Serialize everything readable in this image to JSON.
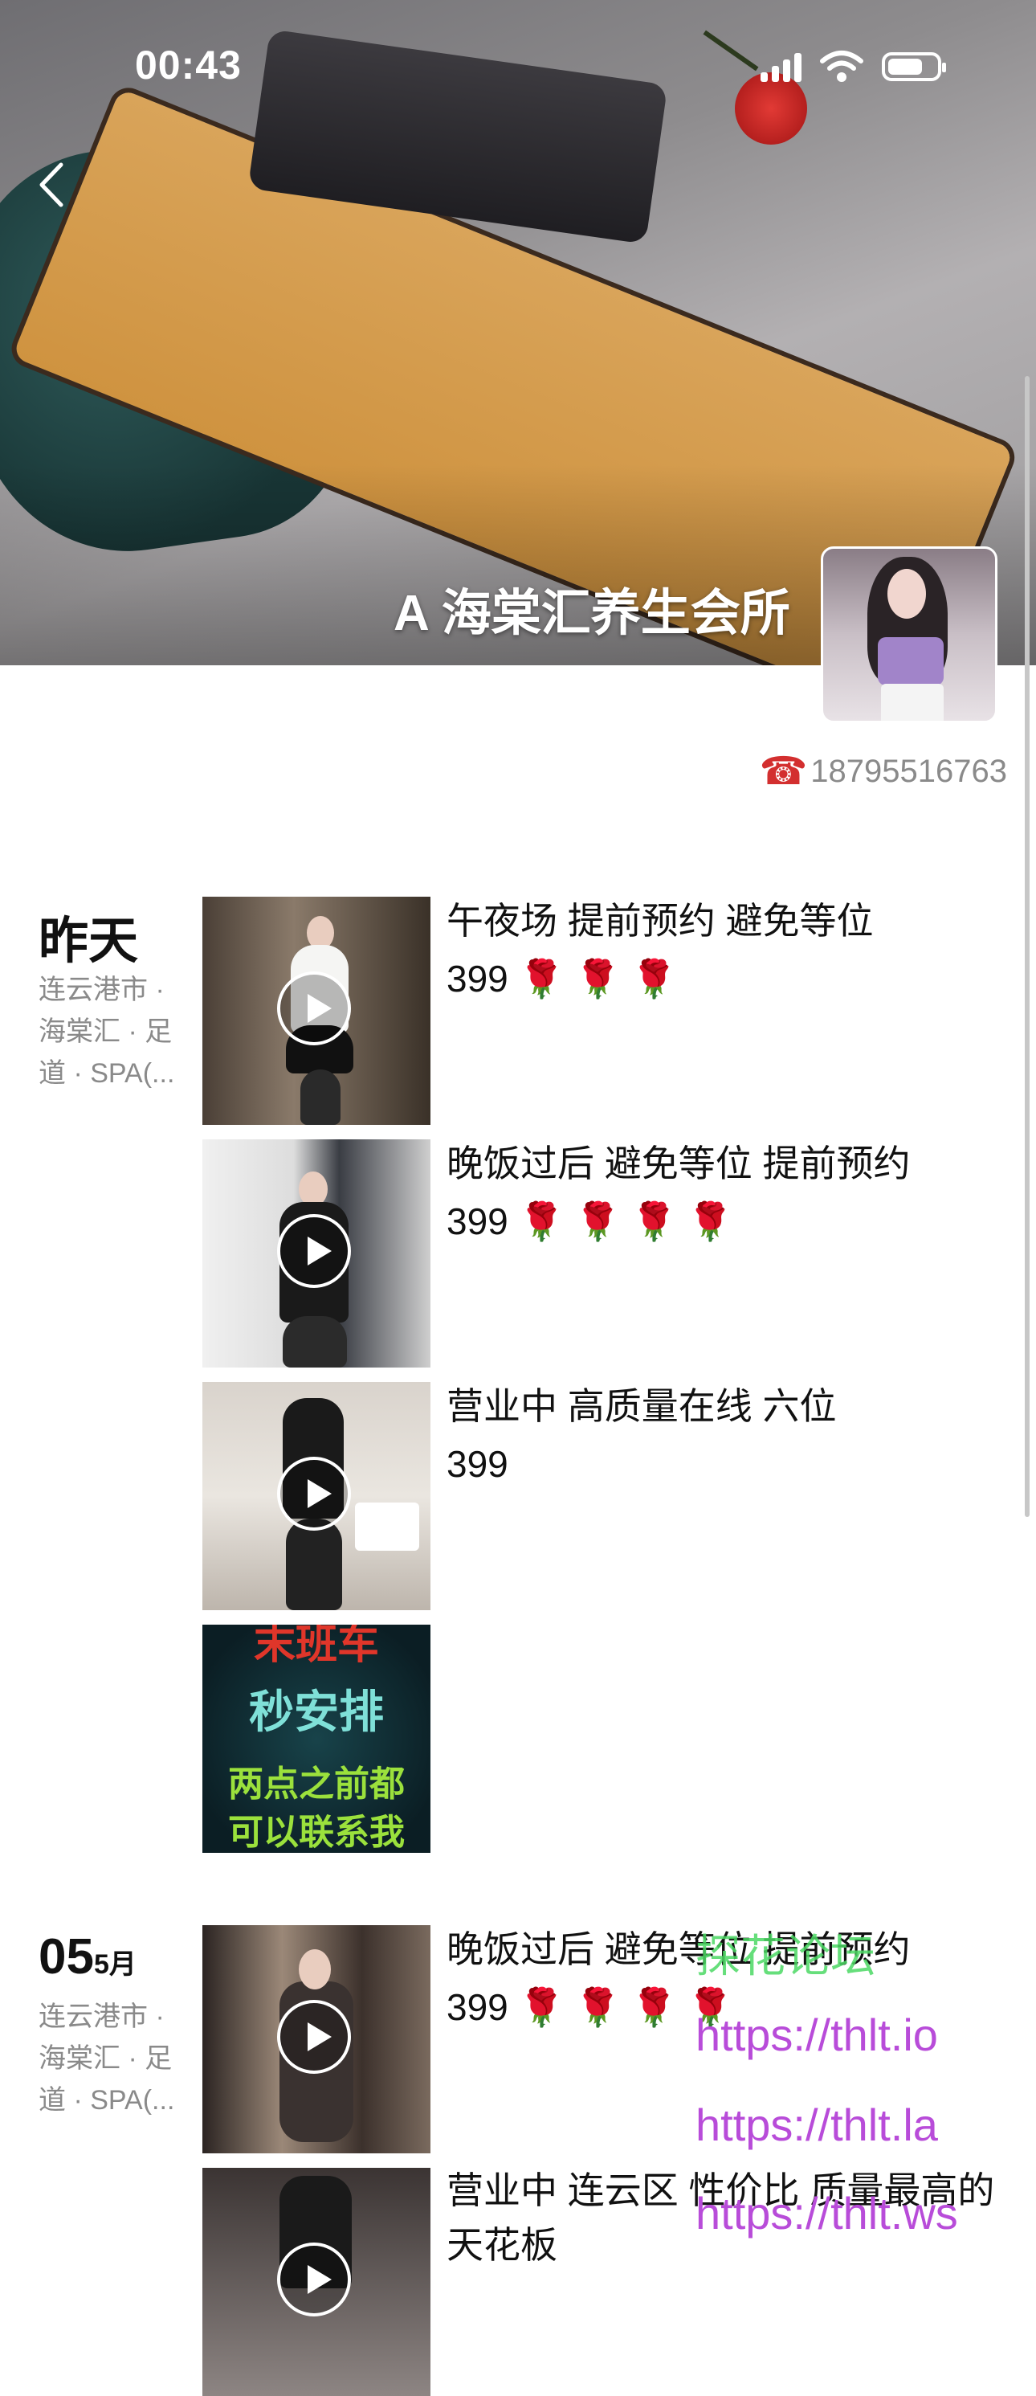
{
  "status_bar": {
    "time": "00:43"
  },
  "header": {
    "title": "A 海棠汇养生会所"
  },
  "contact": {
    "icon": "☎",
    "phone": "18795516763"
  },
  "days": [
    {
      "label": "昨天",
      "location": "连云港市 · 海棠汇 · 足道 · SPA(...",
      "posts": [
        {
          "text": "午夜场 提前预约 避免等位\n399 🌹 🌹 🌹",
          "type": "video"
        },
        {
          "text": "晚饭过后 避免等位 提前预约\n399 🌹 🌹 🌹 🌹",
          "type": "video"
        },
        {
          "text": "营业中 高质量在线  六位\n399",
          "type": "video"
        },
        {
          "text": "",
          "type": "image",
          "poster_lines": [
            "末班车",
            "秒安排",
            "两点之前都",
            "可以联系我"
          ]
        }
      ]
    },
    {
      "label_day": "05",
      "label_month": "5月",
      "location": "连云港市 · 海棠汇 · 足道 · SPA(...",
      "posts": [
        {
          "text": "晚饭过后 避免等位 提前预约\n399 🌹 🌹 🌹 🌹",
          "type": "video"
        },
        {
          "text": "营业中 连云区 性价比 质量最高的天花板",
          "type": "video"
        }
      ]
    }
  ],
  "watermarks": [
    {
      "text": "探花论坛",
      "color": "#4cd964"
    },
    {
      "text": "https://thlt.io",
      "color": "#b84cd9"
    },
    {
      "text": "https://thlt.la",
      "color": "#b84cd9"
    },
    {
      "text": "https://thlt.ws",
      "color": "#b84cd9"
    }
  ]
}
